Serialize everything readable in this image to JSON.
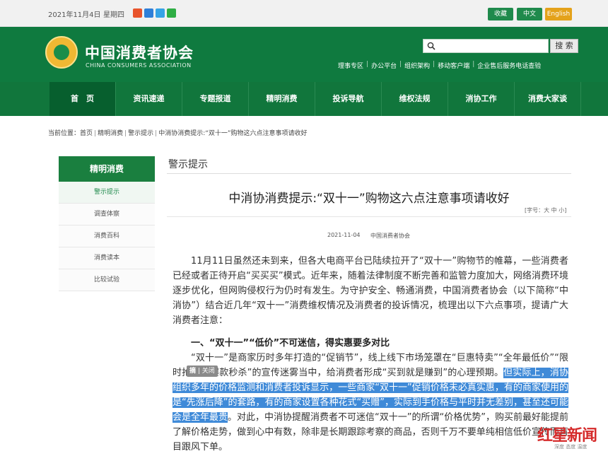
{
  "topbar": {
    "date": "2021年11月4日",
    "weekday": "星期四",
    "social_icons": [
      "sina-weibo-icon",
      "qq-icon",
      "tencent-weibo-icon",
      "wechat-icon"
    ],
    "buttons": [
      "收藏",
      "中文",
      "English"
    ]
  },
  "header": {
    "site_name_cn": "中国消费者协会",
    "site_name_en": "CHINA CONSUMERS ASSOCIATION",
    "search_placeholder": "",
    "search_button": "搜 索",
    "quick_links": [
      "理事专区",
      "办公平台",
      "组织架构",
      "移动客户端",
      "企业售后服务电话查验"
    ]
  },
  "nav": {
    "items": [
      "首　页",
      "资讯速递",
      "专题报道",
      "精明消费",
      "投诉导航",
      "维权法规",
      "消协工作",
      "消费大家谈"
    ]
  },
  "breadcrumb": {
    "prefix": "当前位置：",
    "items": [
      "首页",
      "精明消费",
      "警示提示",
      "中消协消费提示:“双十一”购物这六点注意事项请收好"
    ]
  },
  "sidebar": {
    "title": "精明消费",
    "items": [
      "警示提示",
      "调查体察",
      "消费百科",
      "消费读本",
      "比较试验"
    ]
  },
  "main": {
    "section_title": "警示提示",
    "article_title": "中消协消费提示:“双十一”购物这六点注意事项请收好",
    "font_size_label": "[字号：大 中 小]",
    "date": "2021-11-04",
    "source": "中国消费者协会",
    "para1": "11月11日虽然还未到来，但各大电商平台已陆续拉开了“双十一”购物节的帷幕，一些消费者已经或者正待开启“买买买”模式。近年来，随着法律制度不断完善和监管力度加大，网络消费环境逐步优化，但网购侵权行为仍时有发生。为守护安全、畅通消费，中国消费者协会（以下简称“中消协”）结合近几年“双十一”消费维权情况及消费者的投诉情况，梳理出以下六点事项，提请广大消费者注意：",
    "heading1": "一、“双十一”“低价”不可迷信，得实惠要多对比",
    "para2_before": "“双十一”是商家历时多年打造的“促销节”，线上线下市场笼罩在“巨惠特卖”“全年最低价”“限时抢购”“爆款秒杀”的宣传迷雾当中，给消费者形成“买到就是赚到”的心理预期。",
    "para2_highlight": "但实际上，消协组织多年的价格监测和消费者投诉显示，一些商家“双十一”促销价格未必真实惠，有的商家使用的是“先涨后降”的套路，有的商家设置各种花式“买赠”，实际到手价格与平时并无差别，甚至还可能会是全年最贵",
    "para2_after": "。对此，中消协提醒消费者不可迷信“双十一”的所谓“价格优势”，购买前最好能提前了解价格走势，做到心中有数，除非是长期跟踪考察的商品，否则千万不要单纯相信低价宣传而盲目跟风下单。"
  },
  "tooltip": {
    "excerpt": "摘",
    "close": "关闭"
  },
  "watermark": {
    "brand": "红星新闻",
    "slogan": "深度 态度 温度"
  },
  "colors": {
    "brand_green": "#11763c",
    "highlight_blue": "#3f8ad8",
    "english_orange": "#e4a21b"
  }
}
